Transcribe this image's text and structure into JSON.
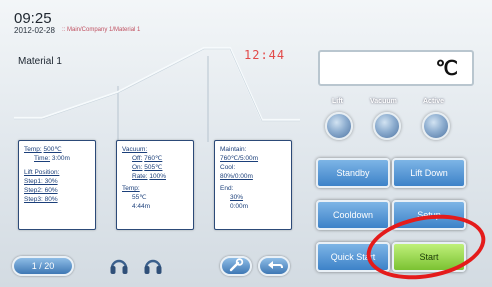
{
  "header": {
    "time": "09:25",
    "date": "2012-02-28",
    "breadcrumb": ":: Main/Company 1/Material 1"
  },
  "material_label": "Material 1",
  "timer": "12:44",
  "profile_panels": {
    "left": {
      "temp_label": "Temp:",
      "temp_value": "500℃",
      "time_label": "Time:",
      "time_value": "3:00m",
      "lift_position_label": "Lift Position:",
      "step1": "Step1: 30%",
      "step2": "Step2: 60%",
      "step3": "Step3: 80%"
    },
    "middle": {
      "vacuum_label": "Vacuum:",
      "off_label": "Off:",
      "off_value": "760℃",
      "on_label": "On:",
      "on_value": "505℃",
      "rate_label": "Rate:",
      "rate_value": "100%",
      "temp_label": "Temp:",
      "temp_value": "55℃",
      "time_value": "4:44m"
    },
    "right": {
      "maintain_label": "Maintain:",
      "maintain_value": "760℃/5:00m",
      "cool_label": "Cool:",
      "cool_value": "80%/0:00m",
      "end_label": "End:",
      "end_pct": "30%",
      "end_time": "0:00m"
    }
  },
  "display": {
    "unit": "℃"
  },
  "indicators": [
    {
      "label": "Lift",
      "icon": "status-lamp"
    },
    {
      "label": "Vacuum",
      "icon": "status-lamp"
    },
    {
      "label": "Active",
      "icon": "status-lamp"
    }
  ],
  "buttons": {
    "standby": "Standby",
    "lift_down": "Lift Down",
    "cooldown": "Cooldown",
    "setup": "Setup",
    "quick_start": "Quick Start",
    "start": "Start"
  },
  "footer": {
    "page": "1 / 20",
    "icons": [
      "headset-icon",
      "headset-icon",
      "wrench-icon",
      "back-arrow-icon"
    ]
  },
  "colors": {
    "accent_blue": "#3d82c8",
    "start_green": "#7bc232",
    "highlight_red": "#e41b1b",
    "timer_red": "#e24a4a"
  }
}
